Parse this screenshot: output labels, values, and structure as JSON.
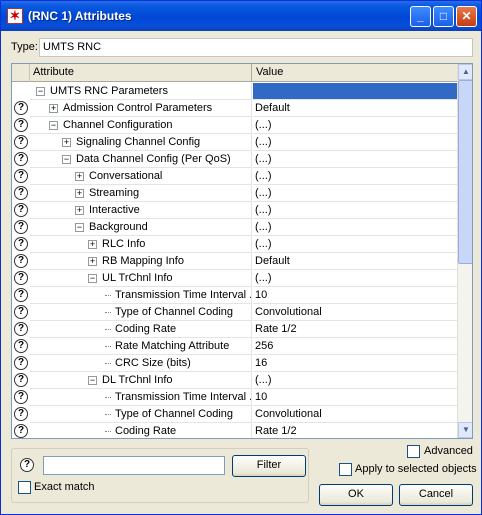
{
  "window": {
    "title": "(RNC 1) Attributes",
    "minimize_glyph": "_",
    "maximize_glyph": "□",
    "close_glyph": "✕"
  },
  "type_label": "Type:",
  "type_value": "UMTS RNC",
  "grid": {
    "header_attribute": "Attribute",
    "header_value": "Value",
    "rows": [
      {
        "label": "UMTS RNC Parameters",
        "value": "",
        "depth": 0,
        "expander": "minus",
        "help": false,
        "selected": true
      },
      {
        "label": "Admission Control Parameters",
        "value": "Default",
        "depth": 1,
        "expander": "plus",
        "help": true
      },
      {
        "label": "Channel Configuration",
        "value": "(...)",
        "depth": 1,
        "expander": "minus",
        "help": true
      },
      {
        "label": "Signaling Channel Config",
        "value": "(...)",
        "depth": 2,
        "expander": "plus",
        "help": true
      },
      {
        "label": "Data Channel Config (Per QoS)",
        "value": "(...)",
        "depth": 2,
        "expander": "minus",
        "help": true
      },
      {
        "label": "Conversational",
        "value": "(...)",
        "depth": 3,
        "expander": "plus",
        "help": true
      },
      {
        "label": "Streaming",
        "value": "(...)",
        "depth": 3,
        "expander": "plus",
        "help": true
      },
      {
        "label": "Interactive",
        "value": "(...)",
        "depth": 3,
        "expander": "plus",
        "help": true
      },
      {
        "label": "Background",
        "value": "(...)",
        "depth": 3,
        "expander": "minus",
        "help": true
      },
      {
        "label": "RLC Info",
        "value": "(...)",
        "depth": 4,
        "expander": "plus",
        "help": true
      },
      {
        "label": "RB Mapping Info",
        "value": "Default",
        "depth": 4,
        "expander": "plus",
        "help": true
      },
      {
        "label": "UL TrChnl Info",
        "value": "(...)",
        "depth": 4,
        "expander": "minus",
        "help": true
      },
      {
        "label": "Transmission Time Interval ...",
        "value": "10",
        "depth": 5,
        "expander": "none",
        "help": true
      },
      {
        "label": "Type of Channel Coding",
        "value": "Convolutional",
        "depth": 5,
        "expander": "none",
        "help": true
      },
      {
        "label": "Coding Rate",
        "value": "Rate 1/2",
        "depth": 5,
        "expander": "none",
        "help": true
      },
      {
        "label": "Rate Matching Attribute",
        "value": "256",
        "depth": 5,
        "expander": "none",
        "help": true
      },
      {
        "label": "CRC Size (bits)",
        "value": "16",
        "depth": 5,
        "expander": "none",
        "help": true
      },
      {
        "label": "DL TrChnl Info",
        "value": "(...)",
        "depth": 4,
        "expander": "minus",
        "help": true
      },
      {
        "label": "Transmission Time Interval ...",
        "value": "10",
        "depth": 5,
        "expander": "none",
        "help": true
      },
      {
        "label": "Type of Channel Coding",
        "value": "Convolutional",
        "depth": 5,
        "expander": "none",
        "help": true
      },
      {
        "label": "Coding Rate",
        "value": "Rate 1/2",
        "depth": 5,
        "expander": "none",
        "help": true
      }
    ]
  },
  "help_glyph": "?",
  "filter": {
    "input_value": "",
    "button_label": "Filter",
    "exact_match_label": "Exact match"
  },
  "advanced_label": "Advanced",
  "apply_label": "Apply to selected objects",
  "ok_label": "OK",
  "cancel_label": "Cancel"
}
